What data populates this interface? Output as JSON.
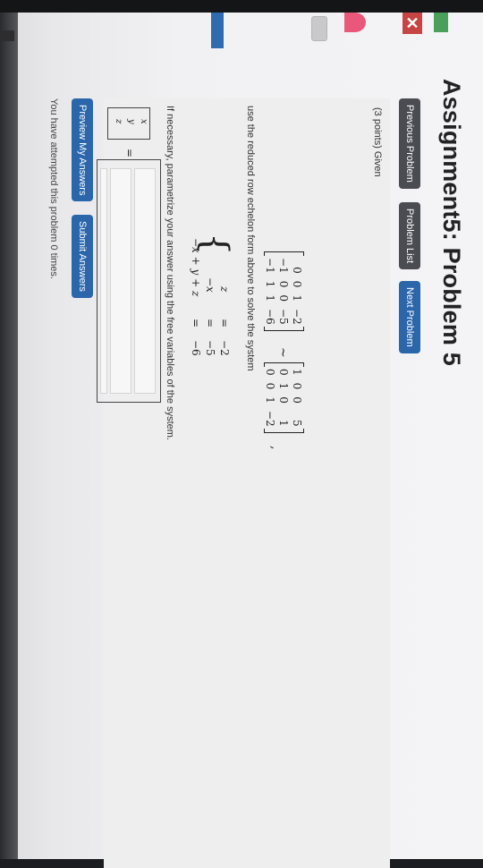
{
  "title": "Assignment5: Problem 5",
  "nav": {
    "previous": "Previous Problem",
    "list": "Problem List",
    "next": "Next Problem"
  },
  "problem": {
    "points": "(3 points) Given",
    "matrix_a": [
      [
        "0",
        "0",
        "1",
        "−2"
      ],
      [
        "−1",
        "0",
        "0",
        "−5"
      ],
      [
        "−1",
        "1",
        "1",
        "−6"
      ]
    ],
    "tilde": "~",
    "matrix_b": [
      [
        "1",
        "0",
        "0",
        "5"
      ],
      [
        "0",
        "1",
        "0",
        "1"
      ],
      [
        "0",
        "0",
        "1",
        "−2"
      ]
    ],
    "comma": ",",
    "instruction": "use the reduced row echelon form above to solve the system",
    "system": [
      {
        "lhs": "z",
        "eq": "=",
        "rhs": "−2"
      },
      {
        "lhs": "−x",
        "eq": "=",
        "rhs": "−5"
      },
      {
        "lhs": "−x + y + z",
        "eq": "=",
        "rhs": "−6"
      }
    ],
    "parametrize": "If necessary, parametrize your answer using the free variables of the system.",
    "vector": [
      "x",
      "y",
      "z"
    ],
    "equals": "="
  },
  "actions": {
    "preview": "Preview My Answers",
    "submit": "Submit Answers"
  },
  "footer": "You have attempted this problem 0 times."
}
